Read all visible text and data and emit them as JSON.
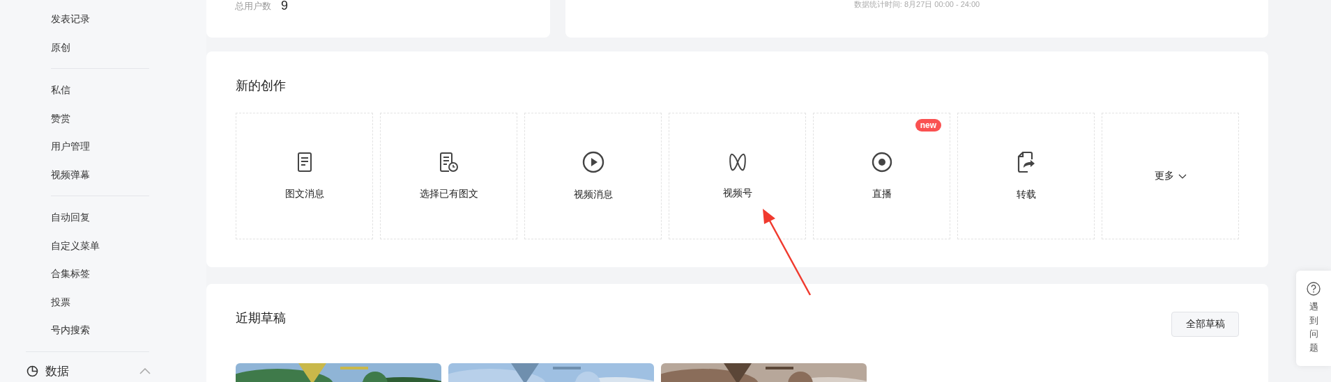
{
  "sidebar": {
    "groups": [
      {
        "items": [
          "发表记录",
          "原创"
        ]
      },
      {
        "items": [
          "私信",
          "赞赏",
          "用户管理",
          "视频弹幕"
        ]
      },
      {
        "items": [
          "自动回复",
          "自定义菜单",
          "合集标签",
          "投票",
          "号内搜索"
        ]
      }
    ],
    "section": {
      "label": "数据",
      "expanded": true
    }
  },
  "stats": {
    "label": "总用户数",
    "value": "9",
    "note": "数据统计时间: 8月27日 00:00 - 24:00"
  },
  "create": {
    "title": "新的创作",
    "tiles": [
      {
        "kind": "create",
        "label": "图文消息"
      },
      {
        "kind": "create",
        "label": "选择已有图文"
      },
      {
        "kind": "create",
        "label": "视频消息"
      },
      {
        "kind": "create",
        "label": "视频号"
      },
      {
        "kind": "create",
        "label": "直播",
        "badge": "new"
      },
      {
        "kind": "create",
        "label": "转载"
      },
      {
        "kind": "more",
        "label": "更多"
      }
    ]
  },
  "drafts": {
    "title": "近期草稿",
    "button": "全部草稿"
  },
  "help": {
    "label": "遇到问题"
  }
}
